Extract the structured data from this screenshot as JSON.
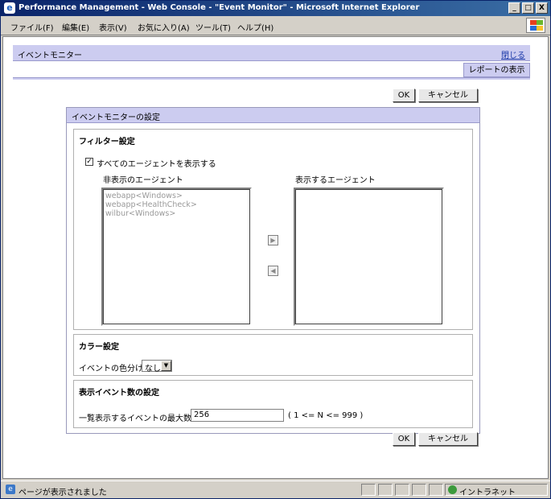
{
  "window": {
    "title": "Performance Management - Web Console - \"Event Monitor\" - Microsoft Internet Explorer",
    "minimize": "_",
    "maximize": "□",
    "close": "X"
  },
  "menu": {
    "items": [
      "ファイル(F)",
      "編集(E)",
      "表示(V)",
      "お気に入り(A)",
      "ツール(T)",
      "ヘルプ(H)"
    ]
  },
  "page": {
    "title": "イベントモニター",
    "close_link": "閉じる",
    "report_tab": "レポートの表示"
  },
  "buttons": {
    "ok": "OK",
    "cancel": "キャンセル"
  },
  "settings": {
    "title": "イベントモニターの設定",
    "filter": {
      "title": "フィルター設定",
      "show_all_label": "すべてのエージェントを表示する",
      "show_all_checked": true,
      "check_mark": "✓",
      "hidden_label": "非表示のエージェント",
      "shown_label": "表示するエージェント",
      "hidden_agents": [
        "webapp<Windows>",
        "webapp<HealthCheck>",
        "wilbur<Windows>"
      ],
      "shown_agents": [],
      "move_right_icon": "▶",
      "move_left_icon": "◀"
    },
    "color": {
      "title": "カラー設定",
      "label": "イベントの色分け",
      "value": "なし",
      "arrow": "▼"
    },
    "event_count": {
      "title": "表示イベント数の設定",
      "label": "一覧表示するイベントの最大数",
      "value": "256",
      "hint": "( 1 <= N <= 999 )"
    }
  },
  "status": {
    "text": "ページが表示されました",
    "zone": "イントラネット"
  }
}
